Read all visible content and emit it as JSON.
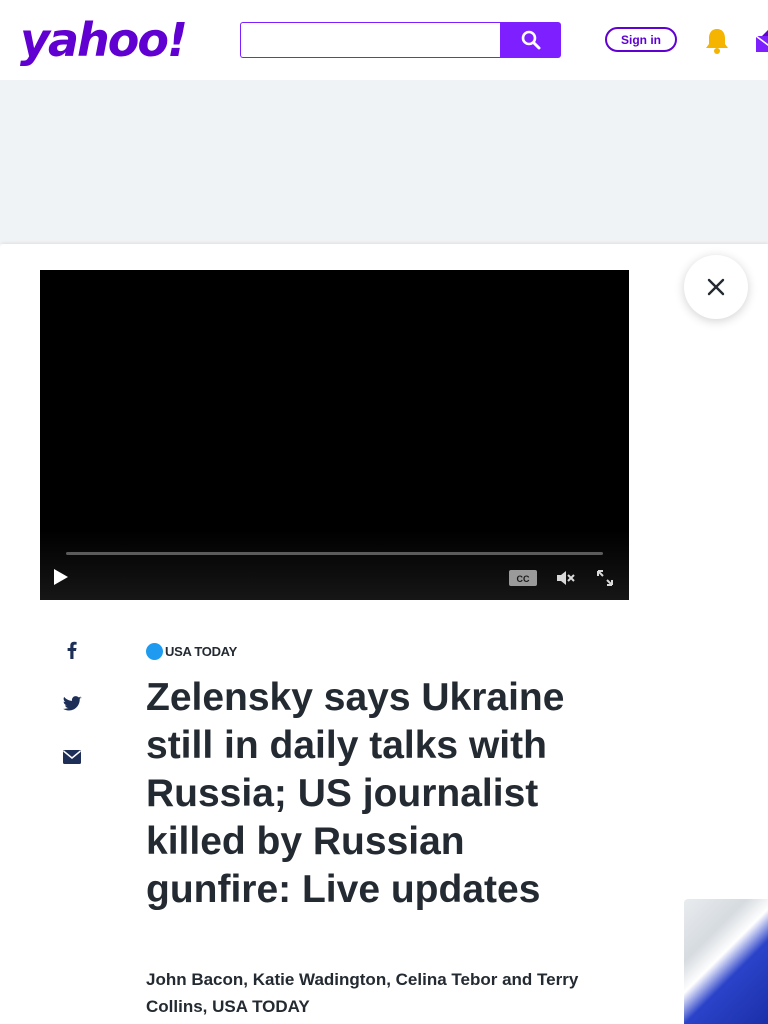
{
  "header": {
    "logo_text": "yahoo!",
    "search": {
      "value": "",
      "placeholder": ""
    },
    "signin_label": "Sign in"
  },
  "video": {
    "controls": [
      "play-icon",
      "cc-icon",
      "mute-icon",
      "fullscreen-icon"
    ],
    "cc_label": "CC"
  },
  "article": {
    "publisher": "USA TODAY",
    "headline": "Zelensky says Ukraine still in daily talks with Russia; US journalist killed by Russian gunfire: Live updates",
    "byline": "John Bacon, Katie Wadington, Celina Tebor and Terry Collins, USA TODAY",
    "share_icons": [
      "facebook-icon",
      "twitter-icon",
      "email-icon"
    ]
  },
  "colors": {
    "brand_purple": "#6001d2",
    "search_purple": "#7e1fff",
    "bell_yellow": "#f5b400",
    "text_dark": "#232a31",
    "share_blue": "#1d2f57"
  }
}
